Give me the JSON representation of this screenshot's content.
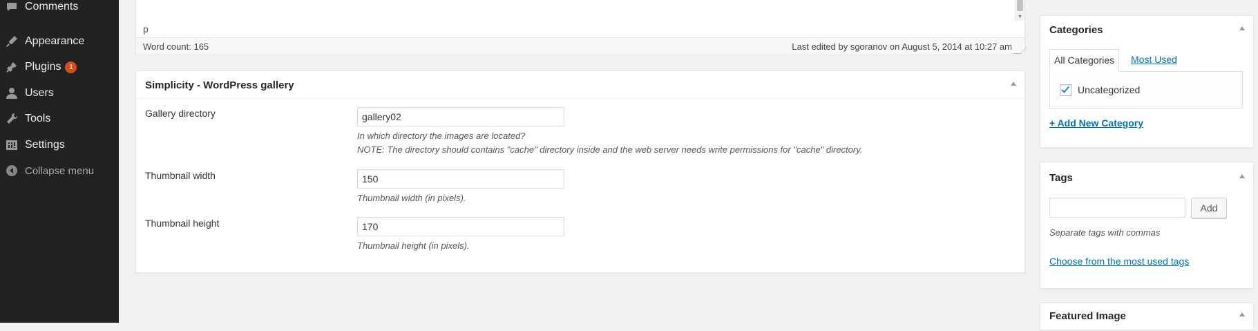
{
  "sidebar": {
    "items": [
      {
        "label": "Comments",
        "icon": "comments-icon"
      },
      {
        "label": "Appearance",
        "icon": "appearance-icon"
      },
      {
        "label": "Plugins",
        "icon": "plugins-icon",
        "badge": "1"
      },
      {
        "label": "Users",
        "icon": "users-icon"
      },
      {
        "label": "Tools",
        "icon": "tools-icon"
      },
      {
        "label": "Settings",
        "icon": "settings-icon"
      },
      {
        "label": "Collapse menu",
        "icon": "collapse-icon"
      }
    ]
  },
  "editor": {
    "path": "p",
    "word_count": "Word count: 165",
    "last_edited": "Last edited by sgoranov on August 5, 2014 at 10:27 am"
  },
  "gallery_box": {
    "title": "Simplicity - WordPress gallery",
    "fields": [
      {
        "label": "Gallery directory",
        "value": "gallery02",
        "desc": [
          "In which directory the images are located?",
          "NOTE: The directory should contains \"cache\" directory inside and the web server needs write permissions for \"cache\" directory."
        ]
      },
      {
        "label": "Thumbnail width",
        "value": "150",
        "desc": [
          "Thumbnail width (in pixels)."
        ]
      },
      {
        "label": "Thumbnail height",
        "value": "170",
        "desc": [
          "Thumbnail height (in pixels)."
        ]
      }
    ]
  },
  "categories_box": {
    "title": "Categories",
    "tabs": [
      "All Categories",
      "Most Used"
    ],
    "items": [
      {
        "label": "Uncategorized",
        "checked": true
      }
    ],
    "add_new": "+ Add New Category"
  },
  "tags_box": {
    "title": "Tags",
    "input_value": "",
    "add_button": "Add",
    "hint": "Separate tags with commas",
    "choose_link": "Choose from the most used tags"
  },
  "featured_box": {
    "title": "Featured Image"
  },
  "colors": {
    "sidebar_bg": "#222222",
    "badge": "#d54e21",
    "link": "#0073aa",
    "checkmark": "#1e8cbe"
  }
}
